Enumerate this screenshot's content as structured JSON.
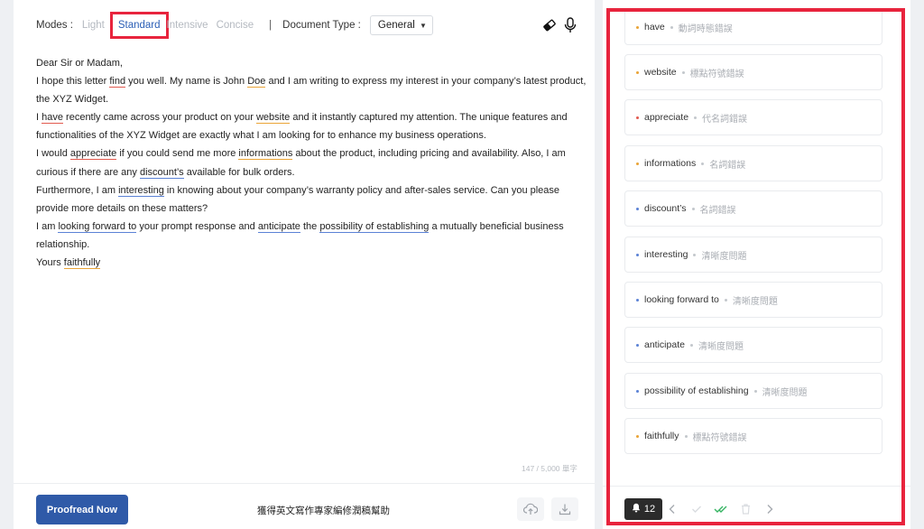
{
  "toolbar": {
    "modes_label": "Modes :",
    "modes": [
      "Light",
      "Standard",
      "Intensive",
      "Concise"
    ],
    "active_mode": "Standard",
    "separator": "|",
    "doctype_label": "Document Type :",
    "doctype_value": "General",
    "icons": [
      "eraser-icon",
      "microphone-icon"
    ]
  },
  "document": {
    "lines": [
      "Dear Sir or Madam,",
      [
        "I hope this letter ",
        "find",
        " you well. My name is John ",
        "Doe",
        " and I am writing to express my interest in your company’s latest product, the XYZ Widget."
      ],
      [
        "I ",
        "have",
        " recently came across your product on your ",
        "website",
        " and it instantly captured my attention. The unique features and functionalities of the XYZ Widget are exactly what I am looking for to enhance my business operations."
      ],
      [
        "I would ",
        "appreciate",
        " if you could send me more ",
        "informations",
        " about the product, including pricing and availability. Also, I am curious if there are any ",
        "discount’s",
        " available for bulk orders."
      ],
      [
        "Furthermore, I am ",
        "interesting",
        " in knowing about your company’s warranty policy and after-sales service. Can you please provide more details on these matters?"
      ],
      [
        "I am ",
        "looking forward to",
        " your prompt response and ",
        "anticipate",
        " the ",
        "possibility of establishing",
        " a mutually beneficial business relationship."
      ],
      [
        "Yours ",
        "faithfully"
      ]
    ],
    "counter": "147 / 5,000 單字"
  },
  "footer": {
    "proofread_label": "Proofread Now",
    "promo_text": "獲得英文寫作專家編修潤稿幫助",
    "icons": [
      "cloud-upload-icon",
      "download-icon"
    ]
  },
  "suggestions": [
    {
      "word": "have",
      "category": "動詞時態錯誤",
      "color": "#eaa437"
    },
    {
      "word": "website",
      "category": "標點符號錯誤",
      "color": "#eaa437"
    },
    {
      "word": "appreciate",
      "category": "代名詞錯誤",
      "color": "#e25a4f"
    },
    {
      "word": "informations",
      "category": "名詞錯誤",
      "color": "#eaa437"
    },
    {
      "word": "discount’s",
      "category": "名詞錯誤",
      "color": "#5b82d6"
    },
    {
      "word": "interesting",
      "category": "清晰度問題",
      "color": "#5b82d6"
    },
    {
      "word": "looking forward to",
      "category": "清晰度問題",
      "color": "#5b82d6"
    },
    {
      "word": "anticipate",
      "category": "清晰度問題",
      "color": "#5b82d6"
    },
    {
      "word": "possibility of establishing",
      "category": "清晰度問題",
      "color": "#5b82d6"
    },
    {
      "word": "faithfully",
      "category": "標點符號錯誤",
      "color": "#eaa437"
    }
  ],
  "suggestion_footer": {
    "count": "12",
    "icons": [
      "bell-icon",
      "chevron-left-icon",
      "check-icon",
      "double-check-icon",
      "trash-icon",
      "chevron-right-icon"
    ]
  }
}
